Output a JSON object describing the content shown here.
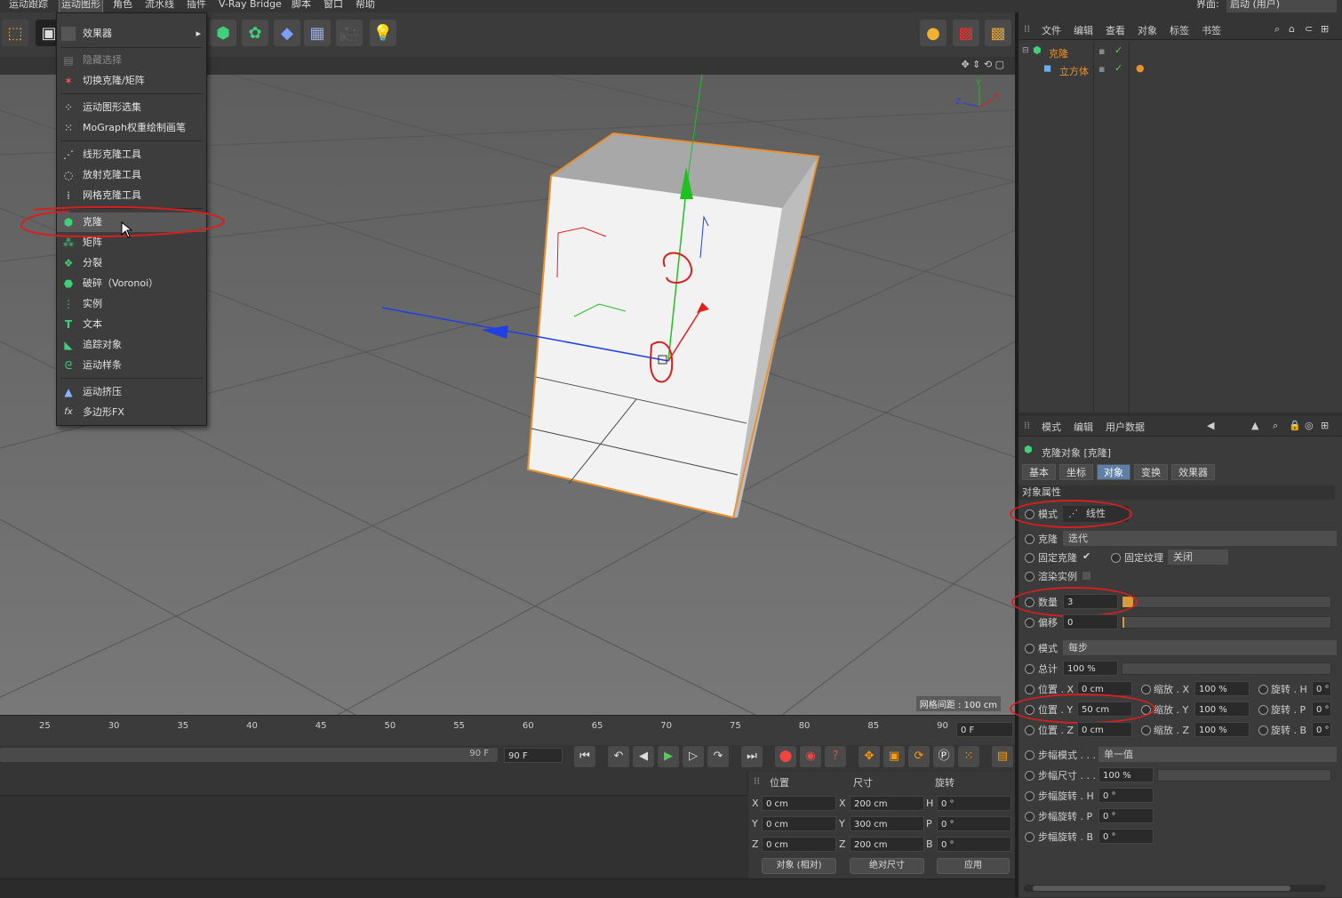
{
  "menubar": {
    "items": [
      "运动跟踪",
      "运动图形",
      "角色",
      "流水线",
      "插件",
      "V-Ray Bridge",
      "脚本",
      "窗口",
      "帮助"
    ],
    "layout_label": "界面:",
    "layout_value": "启动 (用户)"
  },
  "dropdown": {
    "items": [
      {
        "label": "效果器",
        "icon": "effector-icon",
        "submenu": true
      },
      {
        "label": "隐藏选择",
        "icon": "hide-selection-icon",
        "disabled": true
      },
      {
        "label": "切换克隆/矩阵",
        "icon": "toggle-clone-icon"
      },
      {
        "label": "运动图形选集",
        "icon": "mograph-selection-icon"
      },
      {
        "label": "MoGraph权重绘制画笔",
        "icon": "weight-brush-icon"
      },
      {
        "label": "线形克隆工具",
        "icon": "linear-clone-icon"
      },
      {
        "label": "放射克隆工具",
        "icon": "radial-clone-icon"
      },
      {
        "label": "网格克隆工具",
        "icon": "grid-clone-icon"
      },
      {
        "label": "克隆",
        "icon": "cloner-icon",
        "highlighted": true
      },
      {
        "label": "矩阵",
        "icon": "matrix-icon"
      },
      {
        "label": "分裂",
        "icon": "fracture-icon"
      },
      {
        "label": "破碎（Voronoi）",
        "icon": "voronoi-icon"
      },
      {
        "label": "实例",
        "icon": "instance-icon"
      },
      {
        "label": "文本",
        "icon": "text-icon"
      },
      {
        "label": "追踪对象",
        "icon": "tracer-icon"
      },
      {
        "label": "运动样条",
        "icon": "mospline-icon"
      },
      {
        "label": "运动挤压",
        "icon": "extrude-icon"
      },
      {
        "label": "多边形FX",
        "icon": "polyfx-icon"
      }
    ]
  },
  "viewport": {
    "grid_spacing": "网格间距 : 100 cm",
    "axis_labels": {
      "x": "X",
      "y": "Y",
      "z": "Z"
    }
  },
  "timeline": {
    "ticks": [
      "25",
      "30",
      "35",
      "40",
      "45",
      "50",
      "55",
      "60",
      "65",
      "70",
      "75",
      "80",
      "85",
      "90"
    ],
    "current_frame": "0 F",
    "end_frame_slider": "90 F",
    "end_frame": "90 F"
  },
  "coordinates": {
    "headers": {
      "position": "位置",
      "size": "尺寸",
      "rotation": "旋转"
    },
    "rows": [
      {
        "axis": "X",
        "pos": "0 cm",
        "saxis": "X",
        "size": "200 cm",
        "raxis": "H",
        "rot": "0 °"
      },
      {
        "axis": "Y",
        "pos": "0 cm",
        "saxis": "Y",
        "size": "300 cm",
        "raxis": "P",
        "rot": "0 °"
      },
      {
        "axis": "Z",
        "pos": "0 cm",
        "saxis": "Z",
        "size": "200 cm",
        "raxis": "B",
        "rot": "0 °"
      }
    ],
    "mode": "对象 (相对)",
    "size_mode": "绝对尺寸",
    "apply": "应用"
  },
  "object_manager": {
    "menu": [
      "文件",
      "编辑",
      "查看",
      "对象",
      "标签",
      "书签"
    ],
    "objects": [
      {
        "name": "克隆",
        "icon": "cloner-icon"
      },
      {
        "name": "立方体",
        "icon": "cube-icon"
      }
    ]
  },
  "attribute_manager": {
    "menu": [
      "模式",
      "编辑",
      "用户数据"
    ],
    "title": "克隆对象 [克隆]",
    "tabs": [
      "基本",
      "坐标",
      "对象",
      "变换",
      "效果器"
    ],
    "selected_tab": "对象",
    "section": "对象属性",
    "mode_label": "模式",
    "mode_value": "线性",
    "clone_label": "克隆",
    "clone_value": "迭代",
    "fix_clone_label": "固定克隆",
    "fix_texture_label": "固定纹理",
    "fix_texture_value": "关闭",
    "render_instances_label": "渲染实例",
    "count_label": "数量",
    "count_value": "3",
    "count_fill": 0.05,
    "offset_label": "偏移",
    "offset_value": "0",
    "mode2_label": "模式",
    "mode2_value": "每步",
    "total_label": "总计",
    "total_value": "100 %",
    "pos_x_label": "位置 . X",
    "pos_x": "0 cm",
    "pos_y_label": "位置 . Y",
    "pos_y": "50 cm",
    "pos_z_label": "位置 . Z",
    "pos_z": "0 cm",
    "scale_x_label": "缩放 . X",
    "scale_x": "100 %",
    "scale_y_label": "缩放 . Y",
    "scale_y": "100 %",
    "scale_z_label": "缩放 . Z",
    "scale_z": "100 %",
    "rot_h_label": "旋转 . H",
    "rot_h": "0 °",
    "rot_p_label": "旋转 . P",
    "rot_p": "0 °",
    "rot_b_label": "旋转 . B",
    "rot_b": "0 °",
    "step_mode_label": "步幅模式 . . .",
    "step_mode_value": "单一值",
    "step_size_label": "步幅尺寸 . . .",
    "step_size_value": "100 %",
    "step_rot_h_label": "步幅旋转 . H",
    "step_rot_h": "0 °",
    "step_rot_p_label": "步幅旋转 . P",
    "step_rot_p": "0 °",
    "step_rot_b_label": "步幅旋转 . B",
    "step_rot_b": "0 °"
  },
  "colors": {
    "selection_orange": "#e8912e",
    "axis_x": "#e02020",
    "axis_y": "#20c020",
    "axis_z": "#2040e0",
    "annotation_red": "#d62020",
    "tab_selected": "#5e7fa6"
  }
}
